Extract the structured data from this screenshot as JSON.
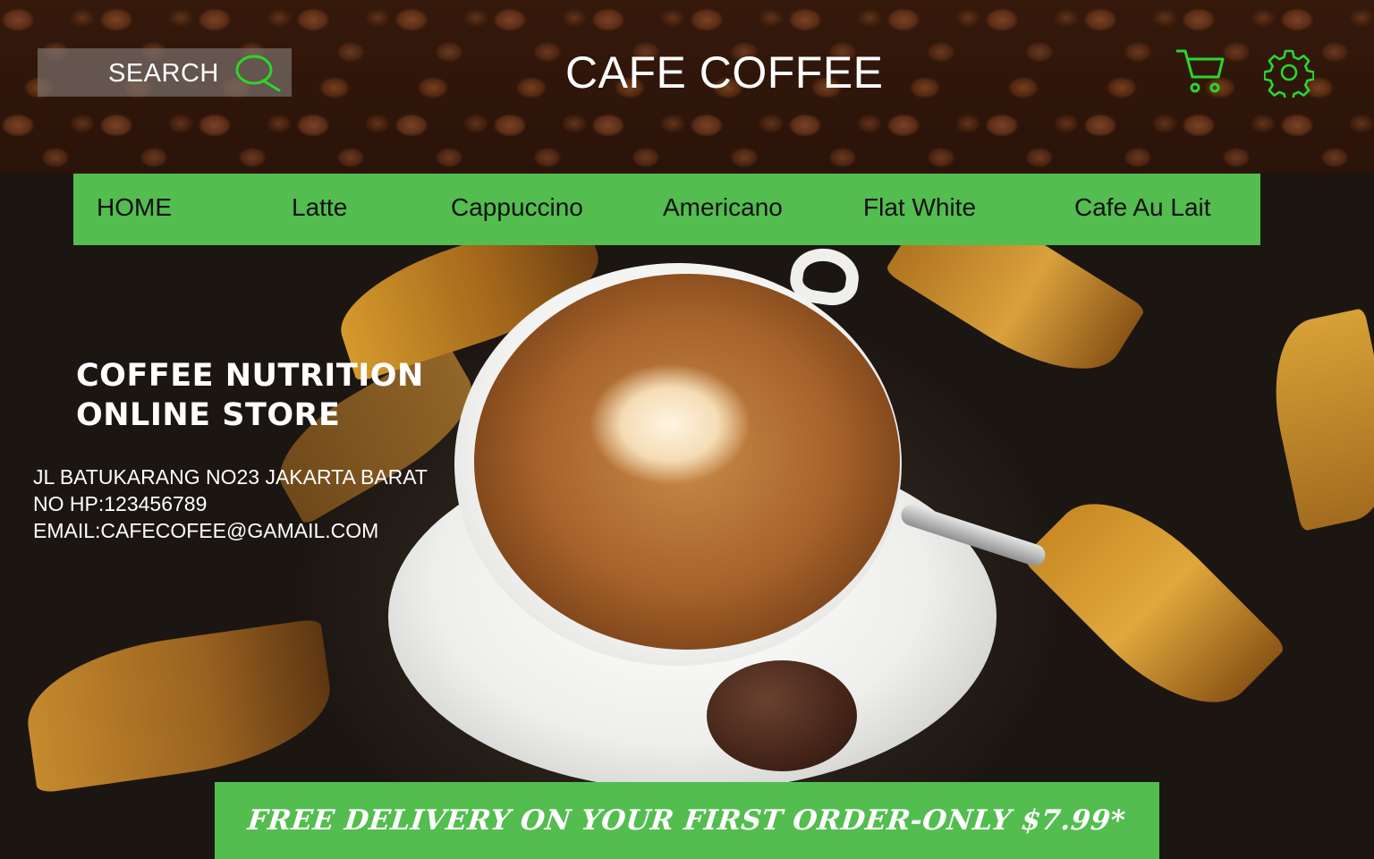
{
  "header": {
    "search_label": "SEARCH",
    "site_title": "CAFE COFFEE",
    "icons": [
      "search-icon",
      "cart-icon",
      "gear-icon"
    ],
    "icon_color": "#2bd62b"
  },
  "nav": {
    "background": "#53bd4f",
    "items": [
      {
        "label": "HOME"
      },
      {
        "label": "Latte"
      },
      {
        "label": "Cappuccino"
      },
      {
        "label": "Americano"
      },
      {
        "label": "Flat White"
      },
      {
        "label": "Cafe Au Lait"
      }
    ]
  },
  "store": {
    "heading_line1": "COFFEE NUTRITION",
    "heading_line2": "ONLINE STORE",
    "address": "JL BATUKARANG NO23 JAKARTA BARAT",
    "phone": "NO HP:123456789",
    "email": "EMAIL:CAFECOFEE@GAMAIL.COM"
  },
  "promo": {
    "text": "FREE DELIVERY ON YOUR FIRST ORDER-ONLY $7.99*",
    "background": "#53bd4f"
  }
}
